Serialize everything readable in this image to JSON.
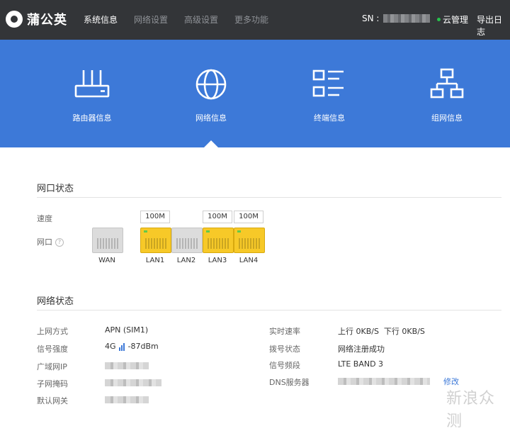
{
  "header": {
    "brand": "蒲公英",
    "nav": [
      "系统信息",
      "网络设置",
      "高级设置",
      "更多功能"
    ],
    "sn_label": "SN :",
    "cloud": "云管理",
    "export": "导出日志"
  },
  "tabs": [
    {
      "label": "路由器信息",
      "icon": "router-icon"
    },
    {
      "label": "网络信息",
      "icon": "globe-icon"
    },
    {
      "label": "终端信息",
      "icon": "list-icon"
    },
    {
      "label": "组网信息",
      "icon": "network-tree-icon"
    }
  ],
  "port_status": {
    "title": "网口状态",
    "speed_label": "速度",
    "port_label": "网口",
    "help": "?",
    "ports": [
      {
        "name": "WAN",
        "speed": "",
        "active": false
      },
      {
        "name": "LAN1",
        "speed": "100M",
        "active": true
      },
      {
        "name": "LAN2",
        "speed": "",
        "active": false
      },
      {
        "name": "LAN3",
        "speed": "100M",
        "active": true
      },
      {
        "name": "LAN4",
        "speed": "100M",
        "active": true
      }
    ]
  },
  "network_status": {
    "title": "网络状态",
    "left": [
      {
        "label": "上网方式",
        "value": "APN (SIM1)"
      },
      {
        "label": "信号强度",
        "value_prefix": "4G",
        "value_suffix": "-87dBm"
      },
      {
        "label": "广域网IP",
        "value": ""
      },
      {
        "label": "子网掩码",
        "value": ""
      },
      {
        "label": "默认网关",
        "value": ""
      }
    ],
    "right": [
      {
        "label": "实时速率",
        "value": "上行 0KB/S  下行 0KB/S"
      },
      {
        "label": "拨号状态",
        "value": "网络注册成功"
      },
      {
        "label": "信号频段",
        "value": "LTE BAND 3"
      },
      {
        "label": "DNS服务器",
        "value": ""
      }
    ],
    "edit": "修改"
  },
  "watermark": "新浪众测",
  "colors": {
    "topbar": "#333538",
    "band": "#3d79d8",
    "port_active": "#f7c928"
  }
}
